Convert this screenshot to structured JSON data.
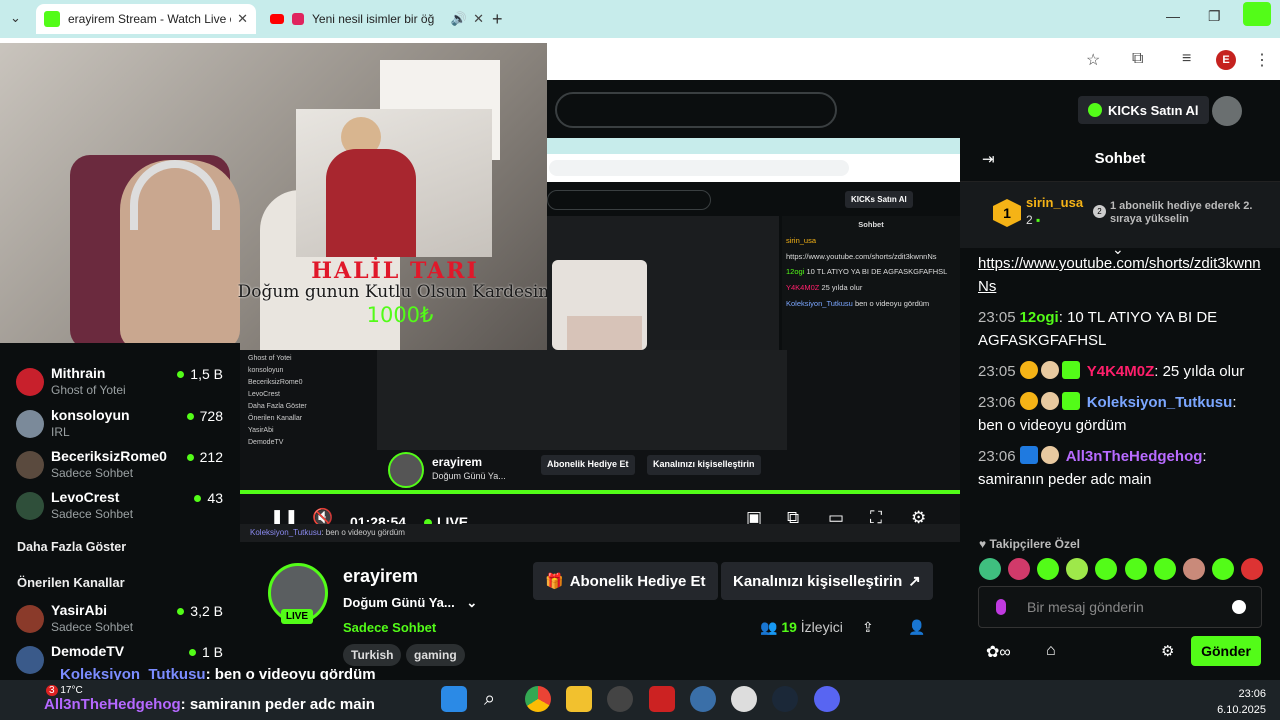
{
  "browser": {
    "tabs": [
      {
        "title": "erayirem Stream - Watch Live o",
        "favicon_color": "#53fc18",
        "active": true
      },
      {
        "title": "Yeni nesil isimler bir öğ",
        "favicon_color": "#e0245e",
        "active": false
      }
    ],
    "profile_initial": "E"
  },
  "header": {
    "kicks_label": "KICKs Satın Al"
  },
  "alert": {
    "name": "HALİL TARI",
    "message": "Doğum gunun Kutlu Olsun Kardesim",
    "amount": "1000₺"
  },
  "sidebar": {
    "channels": [
      {
        "name": "Mithrain",
        "category": "Ghost of Yotei",
        "viewers": "1,5 B"
      },
      {
        "name": "konsoloyun",
        "category": "IRL",
        "viewers": "728"
      },
      {
        "name": "BeceriksizRome0",
        "category": "Sadece Sohbet",
        "viewers": "212"
      },
      {
        "name": "LevoCrest",
        "category": "Sadece Sohbet",
        "viewers": "43"
      }
    ],
    "show_more": "Daha Fazla Göster",
    "recommended_header": "Önerilen Kanallar",
    "recommended": [
      {
        "name": "YasirAbi",
        "category": "Sadece Sohbet",
        "viewers": "3,2 B"
      },
      {
        "name": "DemodeTV",
        "category": "Sadece Sohbet",
        "viewers": "1 B"
      }
    ]
  },
  "player": {
    "time": "01:28:54",
    "live": "LIVE"
  },
  "stream": {
    "name": "erayirem",
    "title": "Doğum Günü Ya...",
    "category": "Sadece Sohbet",
    "live_badge": "LIVE",
    "tags": [
      "Turkish",
      "gaming"
    ],
    "gift_button": "Abonelik Hediye Et",
    "customize_button": "Kanalınızı kişiselleştirin",
    "viewer_count": "19",
    "viewer_label": "İzleyici"
  },
  "chat": {
    "title": "Sohbet",
    "pinned": {
      "user": "sirin_usa",
      "count": "2",
      "rank": "1",
      "next_rank": "2",
      "text": "1 abonelik hediye ederek 2. sıraya yükselin"
    },
    "messages": [
      {
        "time": "",
        "user": "",
        "user_color": "#ffffff",
        "text": "https://www.youtube.com/shorts/zdit3kwnnNs",
        "is_link": true
      },
      {
        "time": "23:05",
        "user": "12ogi",
        "user_color": "#53fc18",
        "text": "10 TL ATIYO YA BI DE AGFASKGFAFHSL"
      },
      {
        "time": "23:05",
        "user": "Y4K4M0Z",
        "user_color": "#ff1f6b",
        "text": "25 yılda olur"
      },
      {
        "time": "23:06",
        "user": "Koleksiyon_Tutkusu",
        "user_color": "#7ba6ff",
        "text": "ben o videoyu gördüm"
      },
      {
        "time": "23:06",
        "user": "All3nTheHedgehog",
        "user_color": "#b86bff",
        "text": "samiranın peder adc main"
      }
    ],
    "followers_only": "Takipçilere Özel",
    "input_placeholder": "Bir mesaj gönderin",
    "send_label": "Gönder"
  },
  "ticker": {
    "line1_user": "Koleksiyon_Tutkusu",
    "line1_text": ": ben o videoyu gördüm",
    "line2_user": "All3nTheHedgehog",
    "line2_text": ": samiranın peder adc main"
  },
  "taskbar": {
    "temperature": "17°C",
    "badge_count": "3",
    "time": "23:06",
    "date": "6.10.2025"
  }
}
